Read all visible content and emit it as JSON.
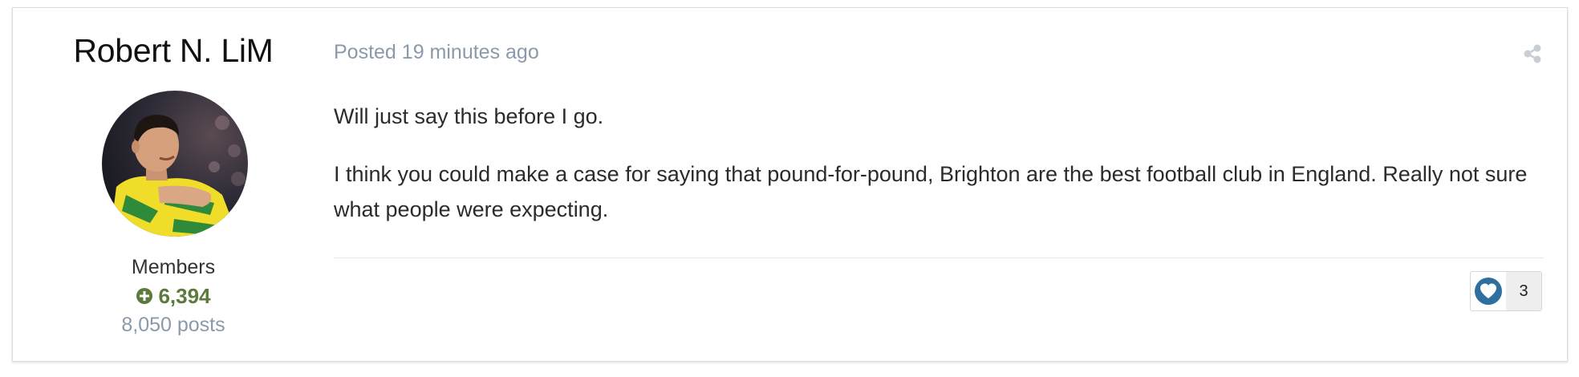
{
  "author": {
    "name": "Robert N. LiM",
    "group": "Members",
    "reputation": "6,394",
    "posts": "8,050 posts"
  },
  "post": {
    "posted_prefix": "Posted",
    "posted_time": "19 minutes ago",
    "paragraphs": [
      "Will just say this before I go.",
      "I think you could make a case for saying that pound-for-pound, Brighton are the best football club in England. Really not sure what people were expecting."
    ]
  },
  "reaction": {
    "count": "3",
    "icon": "heart-icon"
  },
  "colors": {
    "reputation": "#5b7a3b",
    "muted": "#8a9aab",
    "reaction_blue": "#2f6f9f"
  }
}
